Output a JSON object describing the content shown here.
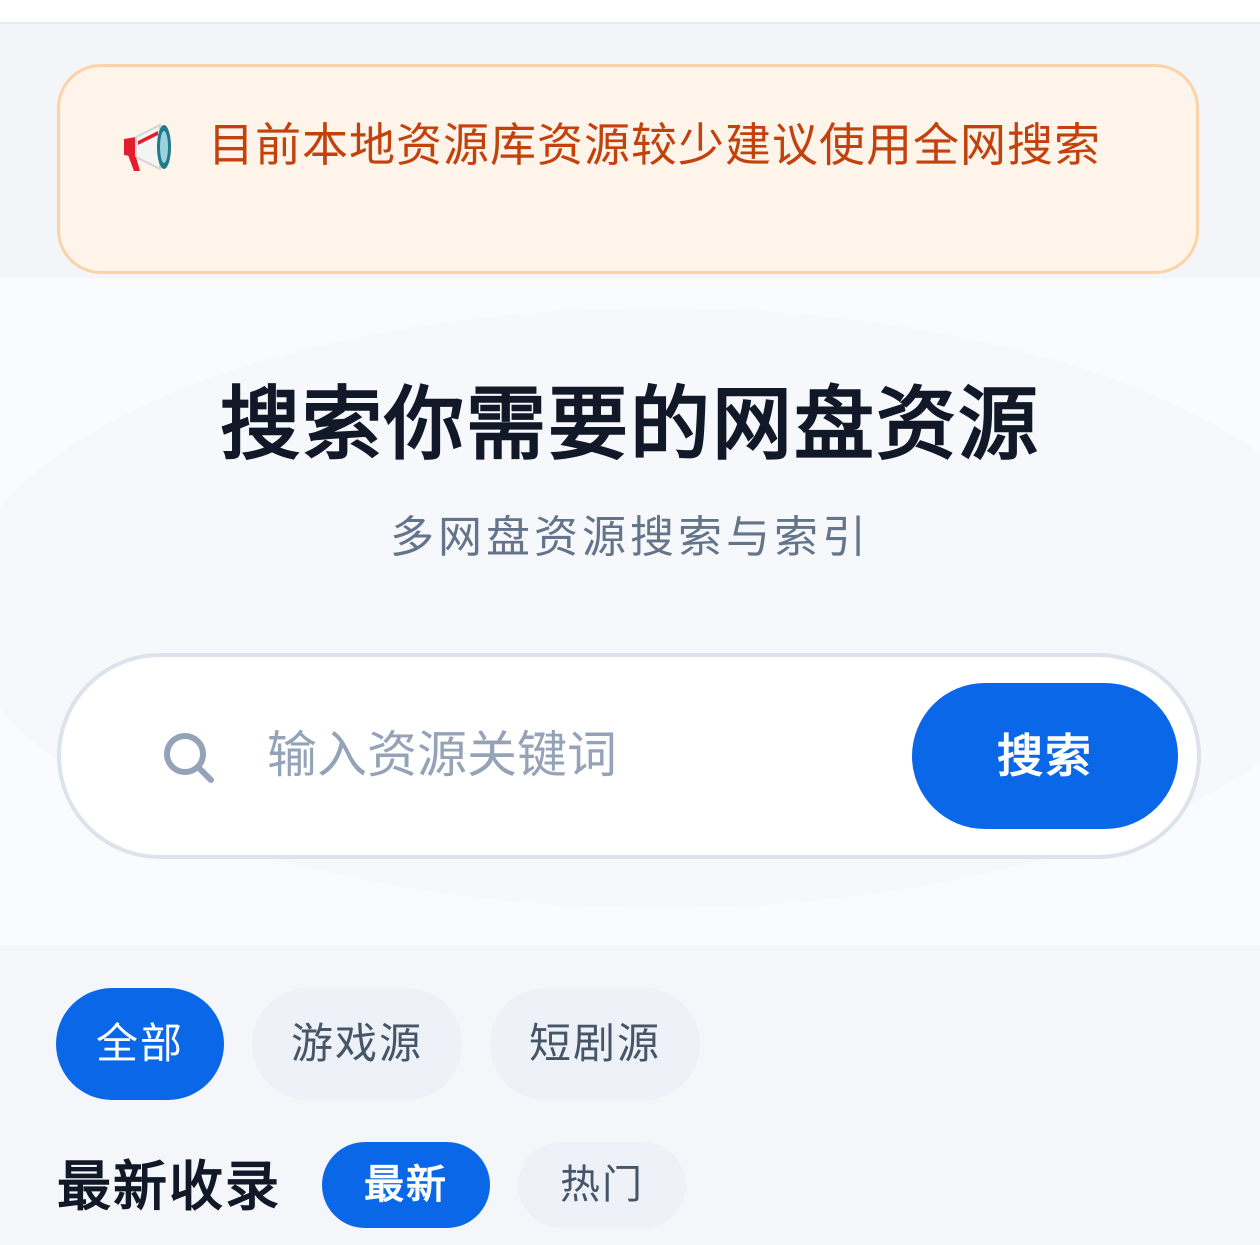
{
  "notice": {
    "icon": "megaphone-icon",
    "text": "目前本地资源库资源较少建议使用全网搜索"
  },
  "hero": {
    "title": "搜索你需要的网盘资源",
    "subtitle": "多网盘资源搜索与索引"
  },
  "search": {
    "icon": "search-icon",
    "placeholder": "输入资源关键词",
    "value": "",
    "button_label": "搜索"
  },
  "categories": [
    {
      "label": "全部",
      "active": true
    },
    {
      "label": "游戏源",
      "active": false
    },
    {
      "label": "短剧源",
      "active": false
    }
  ],
  "latest": {
    "title": "最新收录",
    "sort_tabs": [
      {
        "label": "最新",
        "active": true
      },
      {
        "label": "热门",
        "active": false
      }
    ]
  },
  "colors": {
    "accent": "#0a68e8",
    "notice_text": "#c2410c",
    "notice_bg": "#fff4e9",
    "notice_border": "#fbd3a8",
    "title": "#111827",
    "muted": "#64748b"
  }
}
